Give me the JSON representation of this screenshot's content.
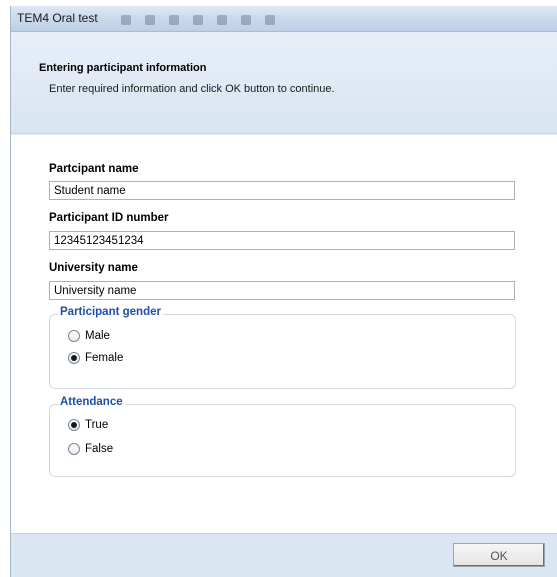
{
  "window": {
    "title": "TEM4 Oral test"
  },
  "header": {
    "title": "Entering participant information",
    "subtitle": "Enter required information and click OK button to continue."
  },
  "form": {
    "participant_name": {
      "label": "Partcipant name",
      "value": "Student name"
    },
    "participant_id": {
      "label": "Participant ID number",
      "value": "12345123451234"
    },
    "university_name": {
      "label": "University name",
      "value": "University name"
    },
    "gender_group": {
      "legend": "Participant gender",
      "options": [
        {
          "label": "Male",
          "checked": false
        },
        {
          "label": "Female",
          "checked": true
        }
      ]
    },
    "attendance_group": {
      "legend": "Attendance",
      "options": [
        {
          "label": "True",
          "checked": true
        },
        {
          "label": "False",
          "checked": false
        }
      ]
    }
  },
  "footer": {
    "ok_label": "OK"
  },
  "colors": {
    "legend_text": "#1f4fa8",
    "header_band": "#dde7f3",
    "footer_band": "#dbe6f3"
  }
}
